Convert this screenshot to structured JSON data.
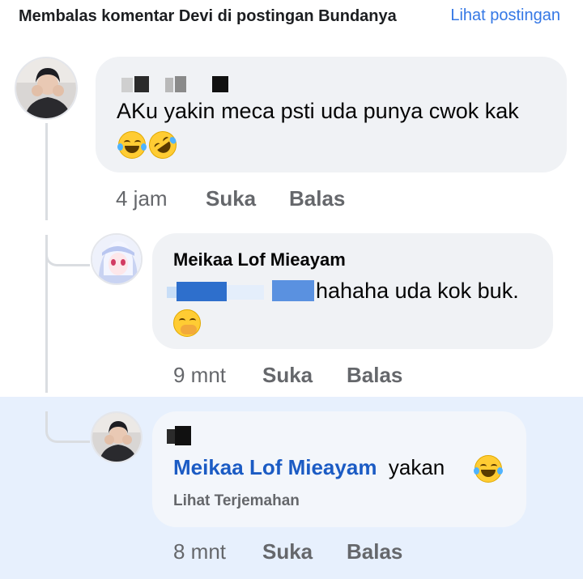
{
  "header": {
    "title": "Membalas komentar Devi di postingan Bundanya",
    "view_post_label": "Lihat postingan"
  },
  "comments": [
    {
      "author": "",
      "text": "AKu yakin meca psti uda punya cwok kak",
      "emojis": [
        "face-with-tears-of-joy-icon",
        "rolling-on-floor-laughing-icon"
      ],
      "time": "4 jam",
      "like_label": "Suka",
      "reply_label": "Balas"
    },
    {
      "author": "Meikaa Lof Mieayam",
      "text": "hahaha uda kok buk.",
      "emojis": [
        "face-with-hand-over-mouth-icon"
      ],
      "time": "9 mnt",
      "like_label": "Suka",
      "reply_label": "Balas"
    },
    {
      "author": "",
      "mention": "Meikaa Lof Mieayam",
      "text": "yakan",
      "emojis": [
        "face-with-tears-of-joy-icon"
      ],
      "translate_label": "Lihat Terjemahan",
      "time": "8 mnt",
      "like_label": "Suka",
      "reply_label": "Balas"
    }
  ],
  "colors": {
    "link": "#3578e5",
    "mention": "#1b5bc4",
    "bubble": "#f0f2f5",
    "highlight": "#e7f0fd"
  }
}
